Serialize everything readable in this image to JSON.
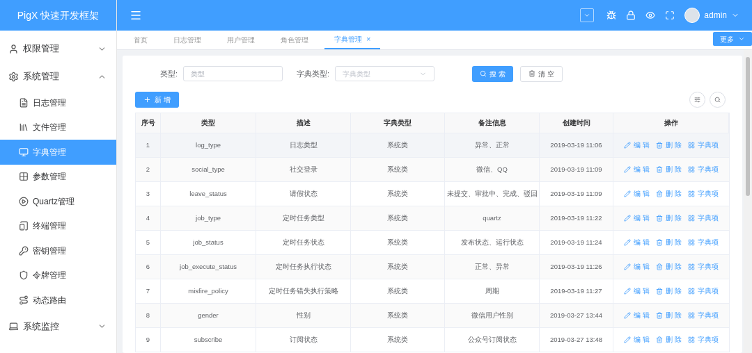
{
  "brand": "PigX 快速开发框架",
  "header": {
    "user": "admin"
  },
  "sidebar": {
    "items": [
      {
        "label": "权限管理",
        "expanded": false
      },
      {
        "label": "系统管理",
        "expanded": true,
        "children": [
          {
            "label": "日志管理",
            "selected": false
          },
          {
            "label": "文件管理",
            "selected": false
          },
          {
            "label": "字典管理",
            "selected": true
          },
          {
            "label": "参数管理",
            "selected": false
          },
          {
            "label": "Quartz管理",
            "selected": false
          },
          {
            "label": "终端管理",
            "selected": false
          },
          {
            "label": "密钥管理",
            "selected": false
          },
          {
            "label": "令牌管理",
            "selected": false
          },
          {
            "label": "动态路由",
            "selected": false
          }
        ]
      },
      {
        "label": "系统监控",
        "expanded": false
      }
    ]
  },
  "tabs": [
    {
      "label": "首页",
      "selected": false
    },
    {
      "label": "日志管理",
      "selected": false
    },
    {
      "label": "用户管理",
      "selected": false
    },
    {
      "label": "角色管理",
      "selected": false
    },
    {
      "label": "字典管理",
      "selected": true,
      "close": "×"
    }
  ],
  "more_button": "更多",
  "filters": [
    {
      "label": "类型:",
      "placeholder": "类型",
      "kind": "input"
    },
    {
      "label": "字典类型:",
      "placeholder": "字典类型",
      "kind": "select"
    }
  ],
  "search_button": "搜 索",
  "clear_button": "清 空",
  "add_button": "新 增",
  "table": {
    "columns": [
      "序号",
      "类型",
      "描述",
      "字典类型",
      "备注信息",
      "创建时间",
      "操作"
    ],
    "rows": [
      {
        "cells": [
          "1",
          "log_type",
          "日志类型",
          "系统类",
          "异常、正常",
          "2019-03-19 11:06"
        ],
        "actions": [
          "编 辑",
          "删 除",
          "字典项"
        ]
      },
      {
        "cells": [
          "2",
          "social_type",
          "社交登录",
          "系统类",
          "微信、QQ",
          "2019-03-19 11:09"
        ],
        "actions": [
          "编 辑",
          "删 除",
          "字典项"
        ]
      },
      {
        "cells": [
          "3",
          "leave_status",
          "请假状态",
          "系统类",
          "未提交、审批中、完成、驳回",
          "2019-03-19 11:09"
        ],
        "actions": [
          "编 辑",
          "删 除",
          "字典项"
        ]
      },
      {
        "cells": [
          "4",
          "job_type",
          "定时任务类型",
          "系统类",
          "quartz",
          "2019-03-19 11:22"
        ],
        "actions": [
          "编 辑",
          "删 除",
          "字典项"
        ]
      },
      {
        "cells": [
          "5",
          "job_status",
          "定时任务状态",
          "系统类",
          "发布状态、运行状态",
          "2019-03-19 11:24"
        ],
        "actions": [
          "编 辑",
          "删 除",
          "字典项"
        ]
      },
      {
        "cells": [
          "6",
          "job_execute_status",
          "定时任务执行状态",
          "系统类",
          "正常、异常",
          "2019-03-19 11:26"
        ],
        "actions": [
          "编 辑",
          "删 除",
          "字典项"
        ]
      },
      {
        "cells": [
          "7",
          "misfire_policy",
          "定时任务错失执行策略",
          "系统类",
          "周期",
          "2019-03-19 11:27"
        ],
        "actions": [
          "编 辑",
          "删 除",
          "字典项"
        ]
      },
      {
        "cells": [
          "8",
          "gender",
          "性别",
          "系统类",
          "微信用户性别",
          "2019-03-27 13:44"
        ],
        "actions": [
          "编 辑",
          "删 除",
          "字典项"
        ]
      },
      {
        "cells": [
          "9",
          "subscribe",
          "订阅状态",
          "系统类",
          "公众号订阅状态",
          "2019-03-27 13:48"
        ],
        "actions": [
          "编 辑",
          "删 除",
          "字典项"
        ]
      }
    ]
  }
}
